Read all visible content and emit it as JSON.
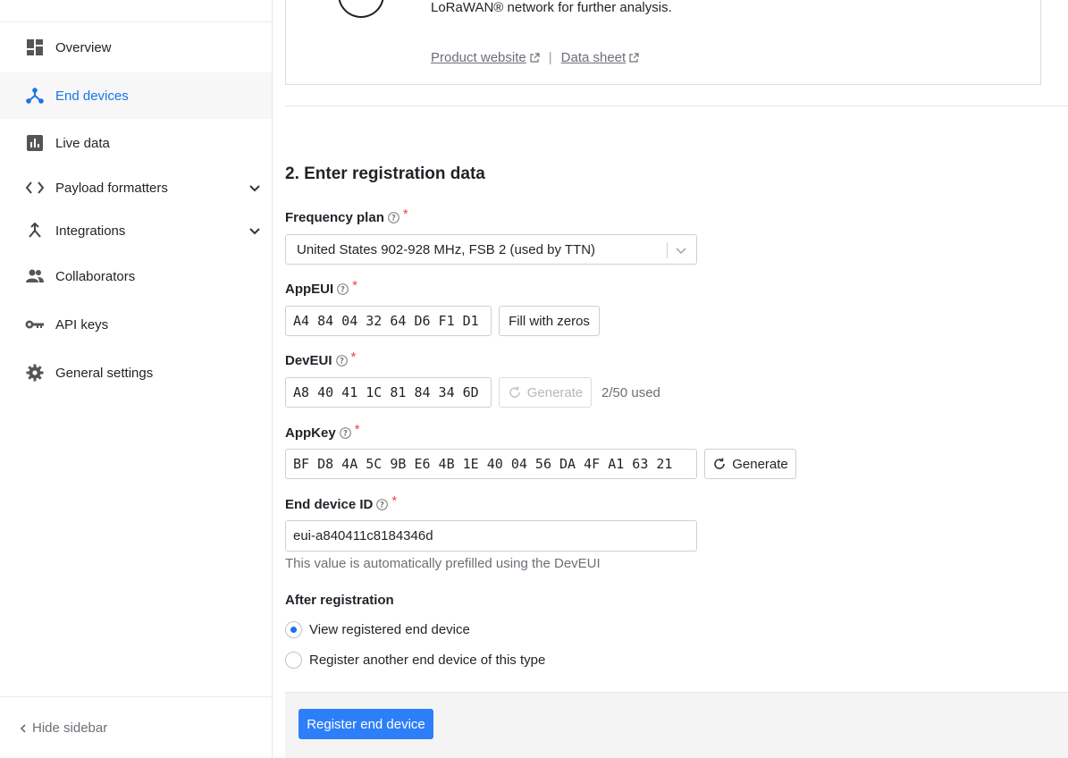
{
  "sidebar": {
    "items": [
      {
        "label": "Overview",
        "icon": "dashboard-icon"
      },
      {
        "label": "End devices",
        "icon": "end-devices-icon",
        "active": true
      },
      {
        "label": "Live data",
        "icon": "bar-chart-icon"
      },
      {
        "label": "Payload formatters",
        "icon": "code-icon",
        "expandable": true
      },
      {
        "label": "Integrations",
        "icon": "integrations-icon",
        "expandable": true
      },
      {
        "label": "Collaborators",
        "icon": "people-icon"
      },
      {
        "label": "API keys",
        "icon": "key-icon"
      },
      {
        "label": "General settings",
        "icon": "gear-icon"
      }
    ],
    "hide_label": "Hide sidebar"
  },
  "device": {
    "description": "LoRaWAN® network for further analysis.",
    "product_website_label": "Product website",
    "separator": "|",
    "data_sheet_label": "Data sheet"
  },
  "form": {
    "section_title": "2. Enter registration data",
    "frequency_plan": {
      "label": "Frequency plan",
      "value": "United States 902-928 MHz, FSB 2 (used by TTN)"
    },
    "app_eui": {
      "label": "AppEUI",
      "value": "A4 84 04 32 64 D6 F1 D1",
      "button": "Fill with zeros"
    },
    "dev_eui": {
      "label": "DevEUI",
      "value": "A8 40 41 1C 81 84 34 6D",
      "button": "Generate",
      "used": "2/50 used"
    },
    "app_key": {
      "label": "AppKey",
      "value": "BF D8 4A 5C 9B E6 4B 1E 40 04 56 DA 4F A1 63 21",
      "button": "Generate"
    },
    "end_device_id": {
      "label": "End device ID",
      "value": "eui-a840411c8184346d",
      "hint": "This value is automatically prefilled using the DevEUI"
    },
    "after_registration": {
      "label": "After registration",
      "options": [
        {
          "label": "View registered end device",
          "checked": true
        },
        {
          "label": "Register another end device of this type",
          "checked": false
        }
      ]
    },
    "required_mark": "*",
    "submit_label": "Register end device"
  },
  "colors": {
    "accent": "#2d7ff9",
    "active_nav": "#1a73e8",
    "required": "#e5484d"
  }
}
